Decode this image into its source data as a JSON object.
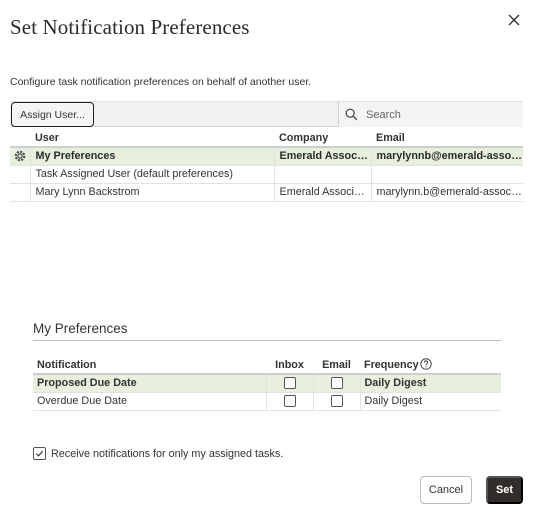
{
  "dialog": {
    "title": "Set Notification Preferences",
    "close_icon": "close-icon",
    "description": "Configure task notification preferences on behalf of another user."
  },
  "toolbar": {
    "assign_label": "Assign User...",
    "search_placeholder": "Search",
    "search_icon": "search-icon"
  },
  "users_table": {
    "columns": [
      "User",
      "Company",
      "Email"
    ],
    "rows": [
      {
        "icon": "gear-icon",
        "user": "My Preferences",
        "company": "Emerald Associates",
        "email": "marylynnb@emerald-associates.com",
        "selected": true
      },
      {
        "icon": "",
        "user": "Task Assigned User (default preferences)",
        "company": "",
        "email": "",
        "selected": false
      },
      {
        "icon": "",
        "user": "Mary Lynn Backstrom",
        "company": "Emerald Associates",
        "email": "marylynn.b@emerald-associates.com",
        "selected": false
      }
    ]
  },
  "preferences": {
    "title": "My Preferences",
    "columns": {
      "notification": "Notification",
      "inbox": "Inbox",
      "email": "Email",
      "frequency": "Frequency",
      "help_icon": "help-icon"
    },
    "rows": [
      {
        "notification": "Proposed Due Date",
        "inbox": false,
        "email": false,
        "frequency": "Daily Digest",
        "selected": true
      },
      {
        "notification": "Overdue Due Date",
        "inbox": false,
        "email": false,
        "frequency": "Daily Digest",
        "selected": false
      }
    ]
  },
  "only_assigned": {
    "label": "Receive notifications for only my assigned tasks.",
    "checked": true
  },
  "footer": {
    "cancel_label": "Cancel",
    "set_label": "Set",
    "set_color": "#312d2a"
  },
  "colors": {
    "selected_row": "#e6f0dc"
  }
}
